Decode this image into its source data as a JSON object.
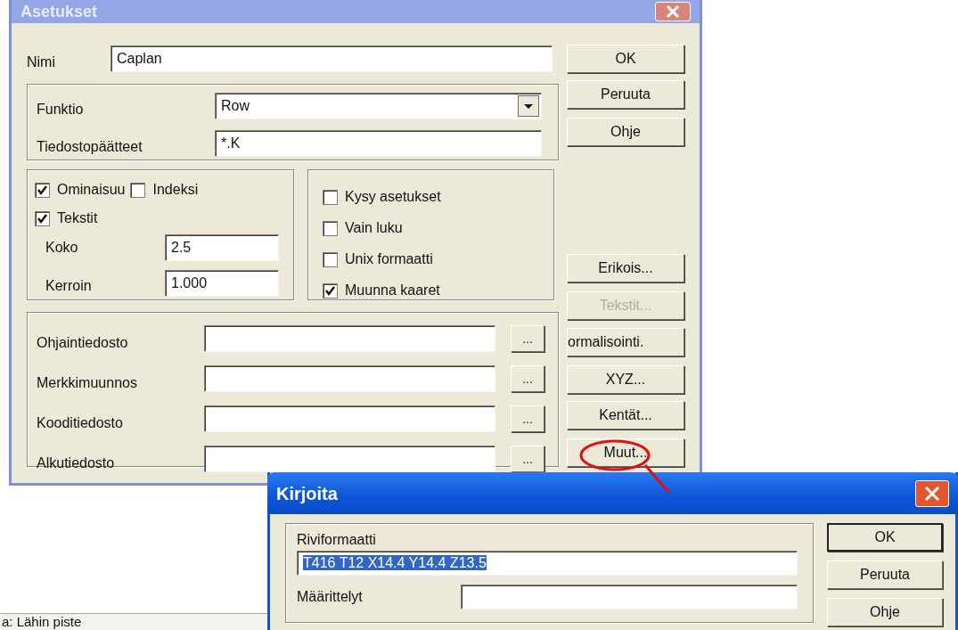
{
  "main_dialog": {
    "title": "Asetukset",
    "name": {
      "label": "Nimi",
      "value": "Caplan"
    },
    "function": {
      "label": "Funktio",
      "value": "Row"
    },
    "extensions": {
      "label": "Tiedostopäätteet",
      "value": "*.K"
    },
    "text_options": [
      {
        "label": "Ominaisuu",
        "checked": true
      },
      {
        "label": "Indeksi",
        "checked": false
      },
      {
        "label": "Tekstit",
        "checked": true
      }
    ],
    "size": {
      "label": "Koko",
      "value": "2.5"
    },
    "factor": {
      "label": "Kerroin",
      "value": "1.000"
    },
    "options": [
      {
        "label": "Kysy asetukset",
        "checked": false
      },
      {
        "label": "Vain luku",
        "checked": false
      },
      {
        "label": "Unix formaatti",
        "checked": false
      },
      {
        "label": "Muunna kaaret",
        "checked": true
      }
    ],
    "files": [
      {
        "label": "Ohjaintiedosto",
        "button": "..."
      },
      {
        "label": "Merkkimuunnos",
        "button": "..."
      },
      {
        "label": "Kooditiedosto",
        "button": "..."
      },
      {
        "label": "Alkutiedosto",
        "button": "..."
      }
    ],
    "buttons": [
      {
        "label": "OK",
        "disabled": false
      },
      {
        "label": "Peruuta",
        "disabled": false
      },
      {
        "label": "Ohje",
        "disabled": false
      },
      {
        "label": "Erikois...",
        "disabled": false
      },
      {
        "label": "Tekstit...",
        "disabled": true
      },
      {
        "label": "ormalisointi.",
        "disabled": false
      },
      {
        "label": "XYZ...",
        "disabled": false
      },
      {
        "label": "Kentät...",
        "disabled": false
      },
      {
        "label": "Muut...",
        "disabled": false
      }
    ]
  },
  "write_dialog": {
    "title": "Kirjoita",
    "row_format": {
      "label": "Riviformaatti",
      "value": "T416 T12 X14.4 Y14.4 Z13.5",
      "selected": true
    },
    "definitions": {
      "label": "Määrittelyt"
    },
    "buttons": [
      {
        "label": "OK",
        "default": true
      },
      {
        "label": "Peruuta",
        "default": false
      },
      {
        "label": "Ohje",
        "default": false
      }
    ]
  },
  "status_bar": {
    "text": "a: Lähin piste"
  }
}
